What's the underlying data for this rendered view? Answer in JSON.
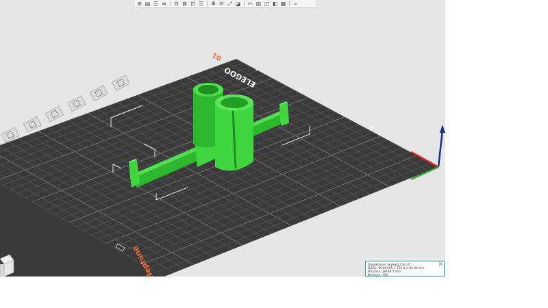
{
  "toolbar": {
    "icons": [
      "add-object-icon",
      "plate-icon",
      "sliders-icon",
      "layers-icon",
      "sep",
      "arrange-icon",
      "split-objects-icon",
      "split-parts-icon",
      "list-icon",
      "sep",
      "move-icon",
      "rotate-icon",
      "scale-icon",
      "place-on-face-icon",
      "sep",
      "cut-icon",
      "paint-supports-icon",
      "seam-icon",
      "hollow-icon",
      "variable-layer-icon",
      "sep",
      "search-icon"
    ]
  },
  "bed": {
    "brand_text": "ELEGOO",
    "corner_number": "01",
    "bottom_label": "Neptune"
  },
  "left_toolbar": {
    "icons": [
      "undo-icon",
      "redo-icon",
      "copy-icon",
      "paste-icon",
      "delete-icon",
      "settings-icon",
      "view-icon",
      "camera-icon"
    ]
  },
  "model": {
    "color": "#3fd63f",
    "shade": "#2cb82c",
    "dark": "#229a22"
  },
  "colors": {
    "bed": "#3a3a3a",
    "grid": "#5b5b5b",
    "accent": "#ee6f3c",
    "axis_z": "#1b2c8f",
    "axis_x": "#d92020",
    "axis_y": "#2fa52f"
  },
  "info_panel": {
    "lines": [
      "Objektname: Keylight_CS4.stl",
      "Größe: 68.89×65 × 161.5 × 65.00 mm",
      "Volumen: 29189.7 mm³",
      "Dreiecke: 334"
    ]
  }
}
